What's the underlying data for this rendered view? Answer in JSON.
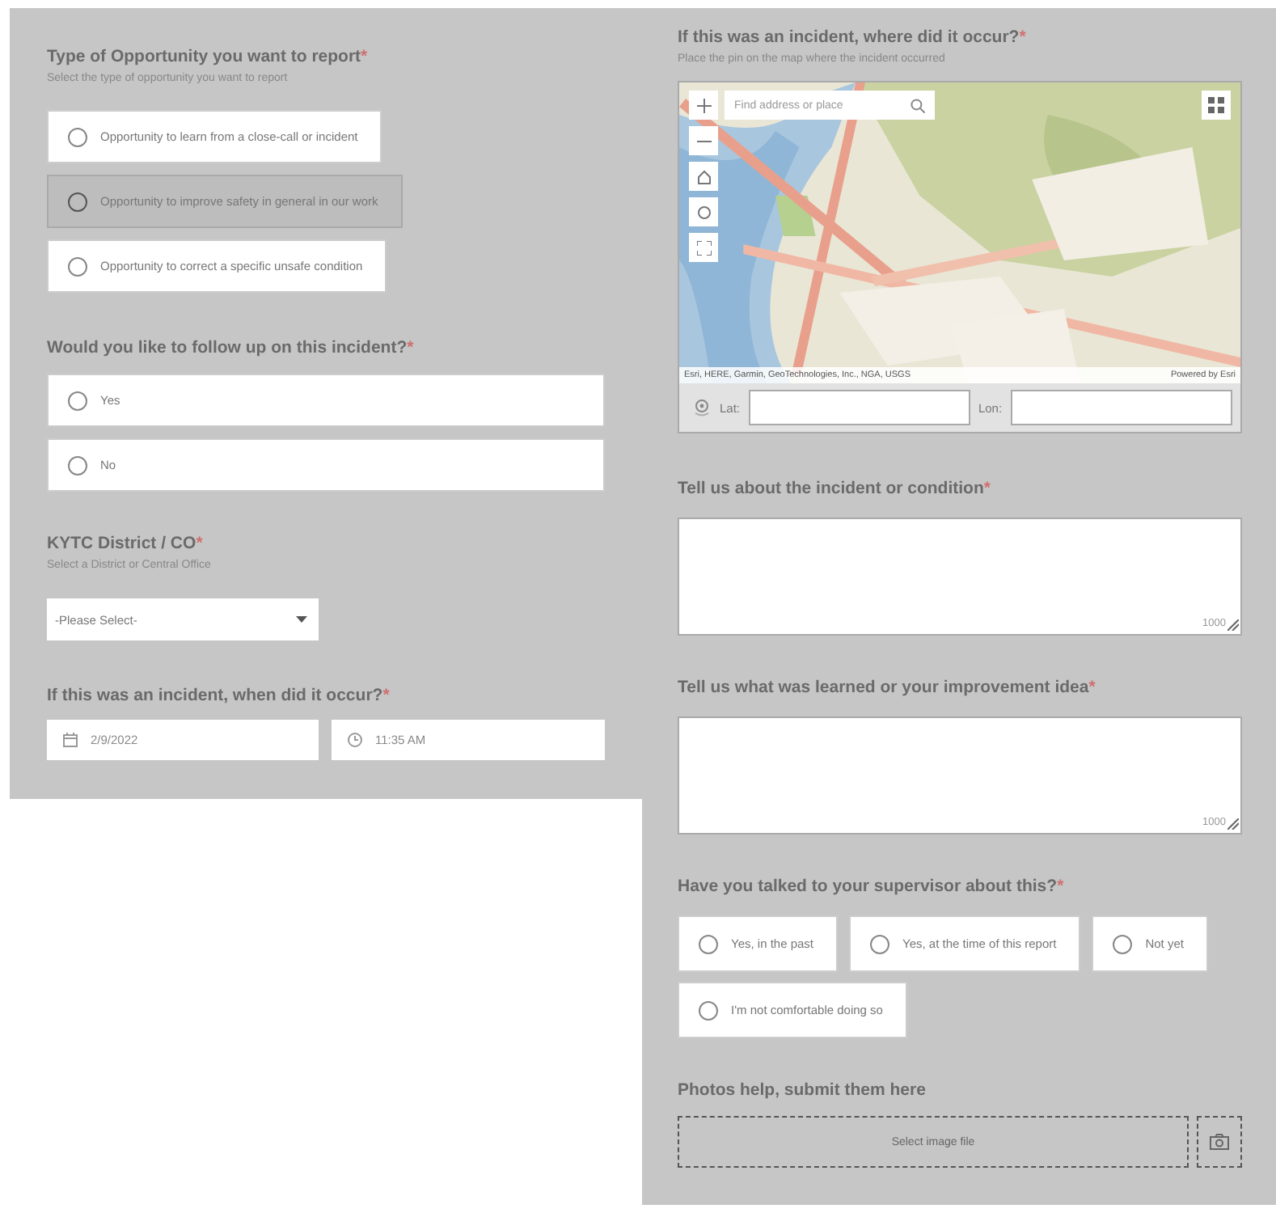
{
  "columns": [
    {
      "fields": [
        {
          "kind": "radio_stack",
          "title": "Type of Opportunity you want to report",
          "required_mark": "*",
          "hint": "Select the type of opportunity you want to report",
          "options": [
            {
              "label": "Opportunity to learn from a close-call or incident",
              "selected": false,
              "hovered": false
            },
            {
              "label": "Opportunity to improve safety in general in our work",
              "selected": false,
              "hovered": true
            },
            {
              "label": "Opportunity to correct a specific unsafe condition",
              "selected": false,
              "hovered": false
            }
          ]
        },
        {
          "kind": "radio_full",
          "title": "Would you like to follow up on this incident?",
          "required_mark": "*",
          "options": [
            {
              "label": "Yes",
              "selected": false,
              "hovered": false
            },
            {
              "label": "No",
              "selected": false,
              "hovered": false
            }
          ]
        },
        {
          "kind": "select",
          "title": "KYTC District / CO",
          "required_mark": "*",
          "hint": "Select a District or Central Office",
          "value": "-Please Select-"
        },
        {
          "kind": "datetime",
          "title": "If this was an incident, when did it occur?",
          "required_mark": "*",
          "date": "2/9/2022",
          "time": "11:35 AM"
        }
      ]
    },
    {
      "fields": [
        {
          "kind": "map",
          "title": "If this was an incident, where did it occur?",
          "required_mark": "*",
          "hint": "Place the pin on the map where the incident occurred",
          "search_placeholder": "Find address or place",
          "attribution": "Esri, HERE, Garmin, GeoTechnologies, Inc., NGA, USGS",
          "powered_by": "Powered by Esri",
          "lat_label": "Lat:",
          "lon_label": "Lon:"
        },
        {
          "kind": "textarea",
          "title": "Tell us about the incident or condition",
          "required_mark": "*",
          "counter": "1000"
        },
        {
          "kind": "textarea",
          "title": "Tell us what was learned or your improvement idea",
          "required_mark": "*",
          "counter": "1000"
        },
        {
          "kind": "radio_wrap",
          "title": "Have you talked to your supervisor about this?",
          "required_mark": "*",
          "options": [
            {
              "label": "Yes, in the past",
              "selected": false,
              "hovered": false
            },
            {
              "label": "Yes, at the time of this report",
              "selected": false,
              "hovered": false
            },
            {
              "label": "Not yet",
              "selected": false,
              "hovered": false
            },
            {
              "label": "I'm not comfortable doing so",
              "selected": false,
              "hovered": false
            }
          ]
        },
        {
          "kind": "file",
          "title": "Photos help, submit them here",
          "button": "Select image file"
        }
      ]
    }
  ]
}
